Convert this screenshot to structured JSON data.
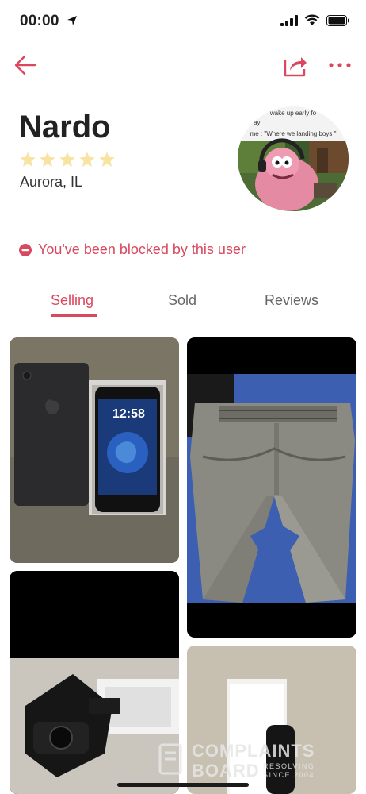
{
  "status_bar": {
    "time": "00:00"
  },
  "profile": {
    "name": "Nardo",
    "rating_stars": 5,
    "location": "Aurora, IL",
    "avatar_text": [
      "wake up early fo",
      "ay",
      "me : \"Where we landing boys \""
    ]
  },
  "blocked_message": "You've been blocked by this user",
  "tabs": [
    {
      "label": "Selling",
      "active": true
    },
    {
      "label": "Sold",
      "active": false
    },
    {
      "label": "Reviews",
      "active": false
    }
  ],
  "listings": [
    {
      "name": "iPhone with box",
      "phone_time": "12:58"
    },
    {
      "name": "Gray jeans"
    },
    {
      "name": "Camera accessory"
    },
    {
      "name": "Watch box"
    }
  ],
  "watermark": {
    "title": "COMPLAINTS",
    "sub": "BOARD",
    "tag_line1": "RESOLVING",
    "tag_line2": "SINCE 2004"
  },
  "colors": {
    "accent": "#d9485e",
    "star": "#f8e3a3"
  }
}
